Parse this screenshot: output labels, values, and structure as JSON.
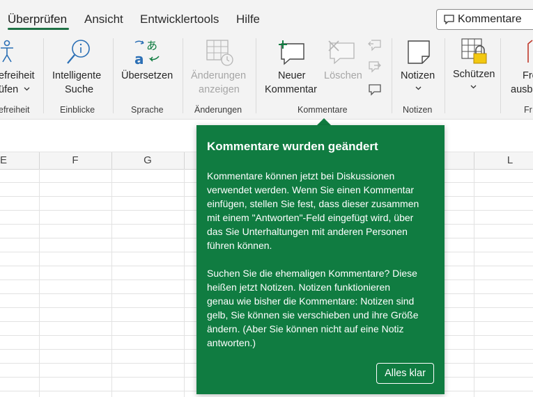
{
  "tabs": [
    {
      "label": "Überprüfen",
      "active": true
    },
    {
      "label": "Ansicht"
    },
    {
      "label": "Entwicklertools"
    },
    {
      "label": "Hilfe"
    }
  ],
  "header": {
    "comments_button": "Kommentare"
  },
  "ribbon": {
    "accessibility": {
      "line1": "efreiheit",
      "line2": "üfen",
      "group": "efreiheit"
    },
    "smart_lookup": {
      "line1": "Intelligente",
      "line2": "Suche",
      "group": "Einblicke"
    },
    "translate": {
      "label": "Übersetzen",
      "group": "Sprache"
    },
    "changes": {
      "line1": "Änderungen",
      "line2": "anzeigen",
      "group": "Änderungen"
    },
    "new_comment": {
      "line1": "Neuer",
      "line2": "Kommentar"
    },
    "delete": {
      "label": "Löschen"
    },
    "comments_group": "Kommentare",
    "notes": {
      "label": "Notizen",
      "group": "Notizen"
    },
    "protect": {
      "label": "Schützen"
    },
    "cut_off": {
      "line1": "Fre",
      "line2": "ausb",
      "group": "Fr"
    }
  },
  "columns": [
    "E",
    "F",
    "G",
    "L"
  ],
  "callout": {
    "title": "Kommentare wurden geändert",
    "para1_lines": [
      "Kommentare können jetzt bei Diskussionen",
      "verwendet werden. Wenn Sie einen Kommentar",
      "einfügen, stellen Sie fest, dass dieser zusammen",
      "mit einem \"Antworten\"-Feld eingefügt wird, über",
      "das Sie Unterhaltungen mit anderen Personen",
      "führen können."
    ],
    "para2_lines": [
      "Suchen Sie die ehemaligen Kommentare? Diese",
      "heißen jetzt Notizen. Notizen funktionieren",
      "genau wie bisher die  Kommentare: Notizen sind",
      "gelb, Sie können sie verschieben und ihre Größe",
      "ändern. (Aber Sie können nicht auf eine Notiz",
      "antworten.)"
    ],
    "ok_button": "Alles klar"
  },
  "colors": {
    "accent": "#107c41",
    "tab_underline": "#1e7145"
  }
}
